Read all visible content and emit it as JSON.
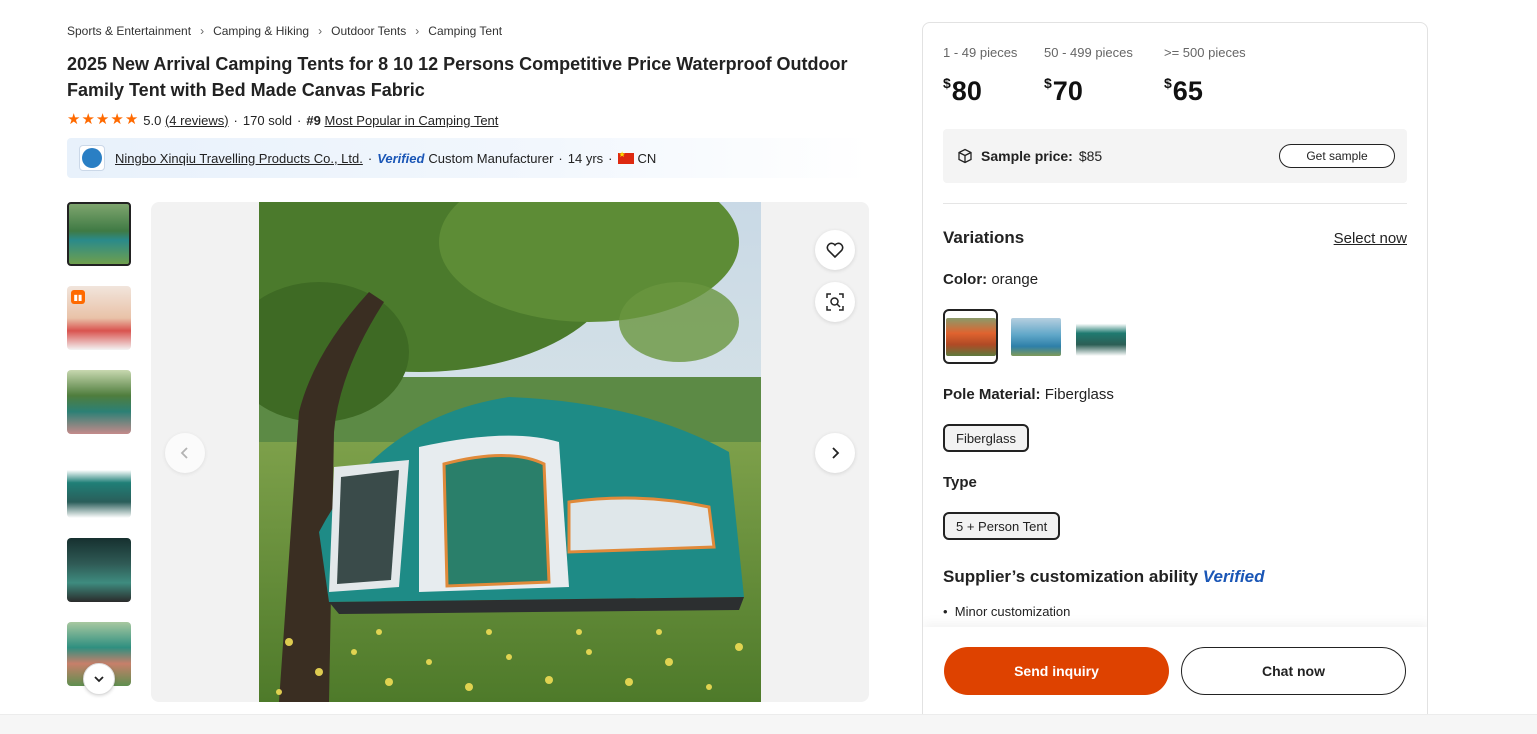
{
  "breadcrumb": [
    "Sports & Entertainment",
    "Camping & Hiking",
    "Outdoor Tents",
    "Camping Tent"
  ],
  "product": {
    "title": "2025 New Arrival Camping Tents for 8 10 12 Persons Competitive Price Waterproof Outdoor Family Tent with Bed Made Canvas Fabric",
    "rating": "5.0",
    "reviews": "(4 reviews)",
    "sold": "170 sold",
    "rank": "#9",
    "rank_label": "Most Popular in Camping Tent"
  },
  "supplier": {
    "name": "Ningbo Xinqiu Travelling Products Co., Ltd.",
    "verified": "Verified",
    "type": "Custom Manufacturer",
    "years": "14 yrs",
    "country": "CN"
  },
  "pricing": {
    "tiers": [
      {
        "qty": "1 - 49 pieces",
        "currency": "$",
        "price": "80"
      },
      {
        "qty": "50 - 499 pieces",
        "currency": "$",
        "price": "70"
      },
      {
        "qty": ">= 500 pieces",
        "currency": "$",
        "price": "65"
      }
    ],
    "sample_label": "Sample price:",
    "sample_price": "$85",
    "sample_button": "Get sample"
  },
  "variations": {
    "title": "Variations",
    "select_now": "Select now",
    "color_label": "Color:",
    "color_value": "orange",
    "pole_label": "Pole Material:",
    "pole_value": "Fiberglass",
    "pole_option": "Fiberglass",
    "type_label": "Type",
    "type_option": "5 + Person Tent"
  },
  "customization": {
    "title": "Supplier’s customization ability",
    "verified": "Verified",
    "item": "Minor customization"
  },
  "actions": {
    "inquiry": "Send inquiry",
    "chat": "Chat now"
  },
  "colors": {
    "accent": "#de4200",
    "star": "#ff6a00",
    "verified": "#1a56b6"
  }
}
